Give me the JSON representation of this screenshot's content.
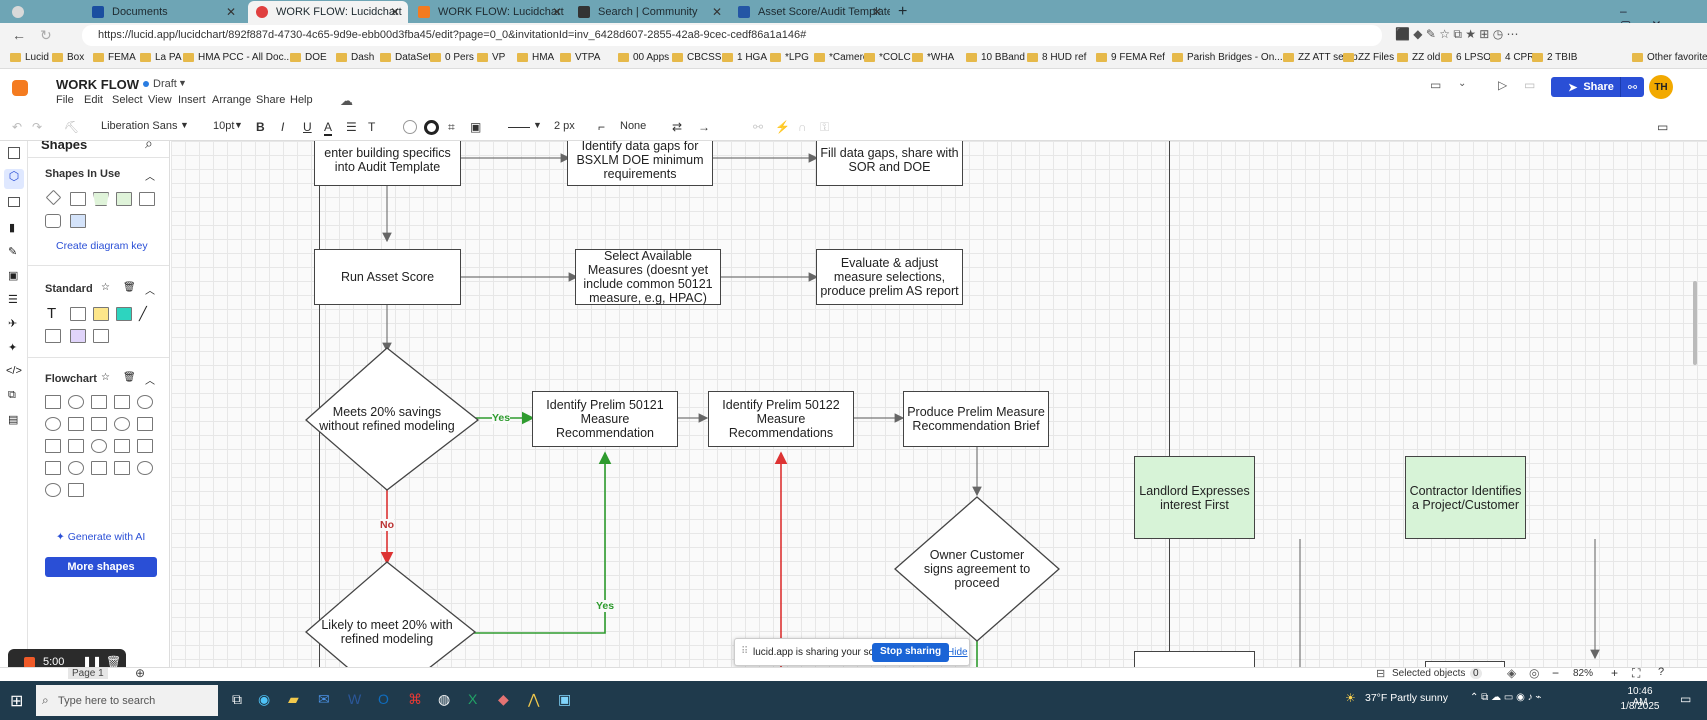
{
  "tabs": [
    {
      "label": "Documents",
      "active": false
    },
    {
      "label": "WORK FLOW: Lucidchart",
      "active": true
    },
    {
      "label": "WORK FLOW: Lucidchart",
      "active": false
    },
    {
      "label": "Search | Community",
      "active": false
    },
    {
      "label": "Asset Score/Audit Template Tool",
      "active": false
    }
  ],
  "address": {
    "url": "https://lucid.app/lucidchart/892f887d-4730-4c65-9d9e-ebb00d3fba45/edit?page=0_0&invitationId=inv_6428d607-2855-42a8-9cec-cedf86a1a146#"
  },
  "bookmarks": [
    "Lucid",
    "Box",
    "FEMA",
    "La PA",
    "HMA PCC - All Doc...",
    "DOE",
    "Dash",
    "DataSets",
    "0 Pers",
    "VP",
    "HMA",
    "VTPA",
    "00 Apps",
    "CBCSS",
    "1 HGA",
    "*LPG",
    "*Cameron",
    "*COLC",
    "*WHA",
    "10 BBand",
    "8 HUD ref",
    "9 FEMA Ref",
    "Parish Bridges - On...",
    "ZZ ATT setup",
    "ZZ Files",
    "ZZ old",
    "6 LPSO",
    "4 CPRI",
    "2 TBIB",
    "Other favorites"
  ],
  "app": {
    "doc_title": "WORK FLOW",
    "status": "Draft",
    "menu": [
      "File",
      "Edit",
      "Select",
      "View",
      "Insert",
      "Arrange",
      "Share",
      "Help"
    ],
    "share_label": "Share",
    "avatar": "TH"
  },
  "toolbar": {
    "font": "Liberation Sans",
    "size": "10pt",
    "line_width": "2 px",
    "endpoint": "None"
  },
  "shapes_panel": {
    "title": "Shapes",
    "in_use": "Shapes In Use",
    "create_key": "Create diagram key",
    "standard": "Standard",
    "flowchart": "Flowchart",
    "generate": "Generate with AI",
    "more_shapes": "More shapes"
  },
  "diagram": {
    "nodes": {
      "audit": "enter building specifics into Audit Template",
      "gaps": "Identify data gaps for BSXLM DOE minimum requirements",
      "fill": "Fill data gaps, share with SOR and DOE",
      "run_asset": "Run Asset Score",
      "select_measures": "Select Available Measures (doesnt yet include common 50121 measure, e.g, HPAC)",
      "evaluate": "Evaluate & adjust measure selections, produce prelim AS report",
      "meets": "Meets 20% savings without refined modeling",
      "id50121": "Identify Prelim 50121 Measure Recommendation",
      "id50122": "Identify Prelim 50122 Measure Recommendations",
      "brief": "Produce Prelim Measure Recommendation Brief",
      "likely": "Likely to meet 20% with refined modeling",
      "owner": "Owner Customer signs agreement to proceed",
      "landlord": "Landlord Expresses interest First",
      "contractor": "Contractor Identifies a Project/Customer"
    },
    "labels": {
      "yes1": "Yes",
      "no": "No",
      "yes2": "Yes"
    }
  },
  "sharebar": {
    "text": "lucid.app is sharing your screen.",
    "stop": "Stop sharing",
    "hide": "Hide"
  },
  "recorder": {
    "time": "5:00"
  },
  "bottom": {
    "page": "Page 1",
    "selected": "Selected objects",
    "count": "0",
    "zoom": "82%"
  },
  "taskbar": {
    "search": "Type here to search",
    "weather": "37°F  Partly sunny",
    "time": "10:46 AM",
    "date": "1/8/2025"
  }
}
